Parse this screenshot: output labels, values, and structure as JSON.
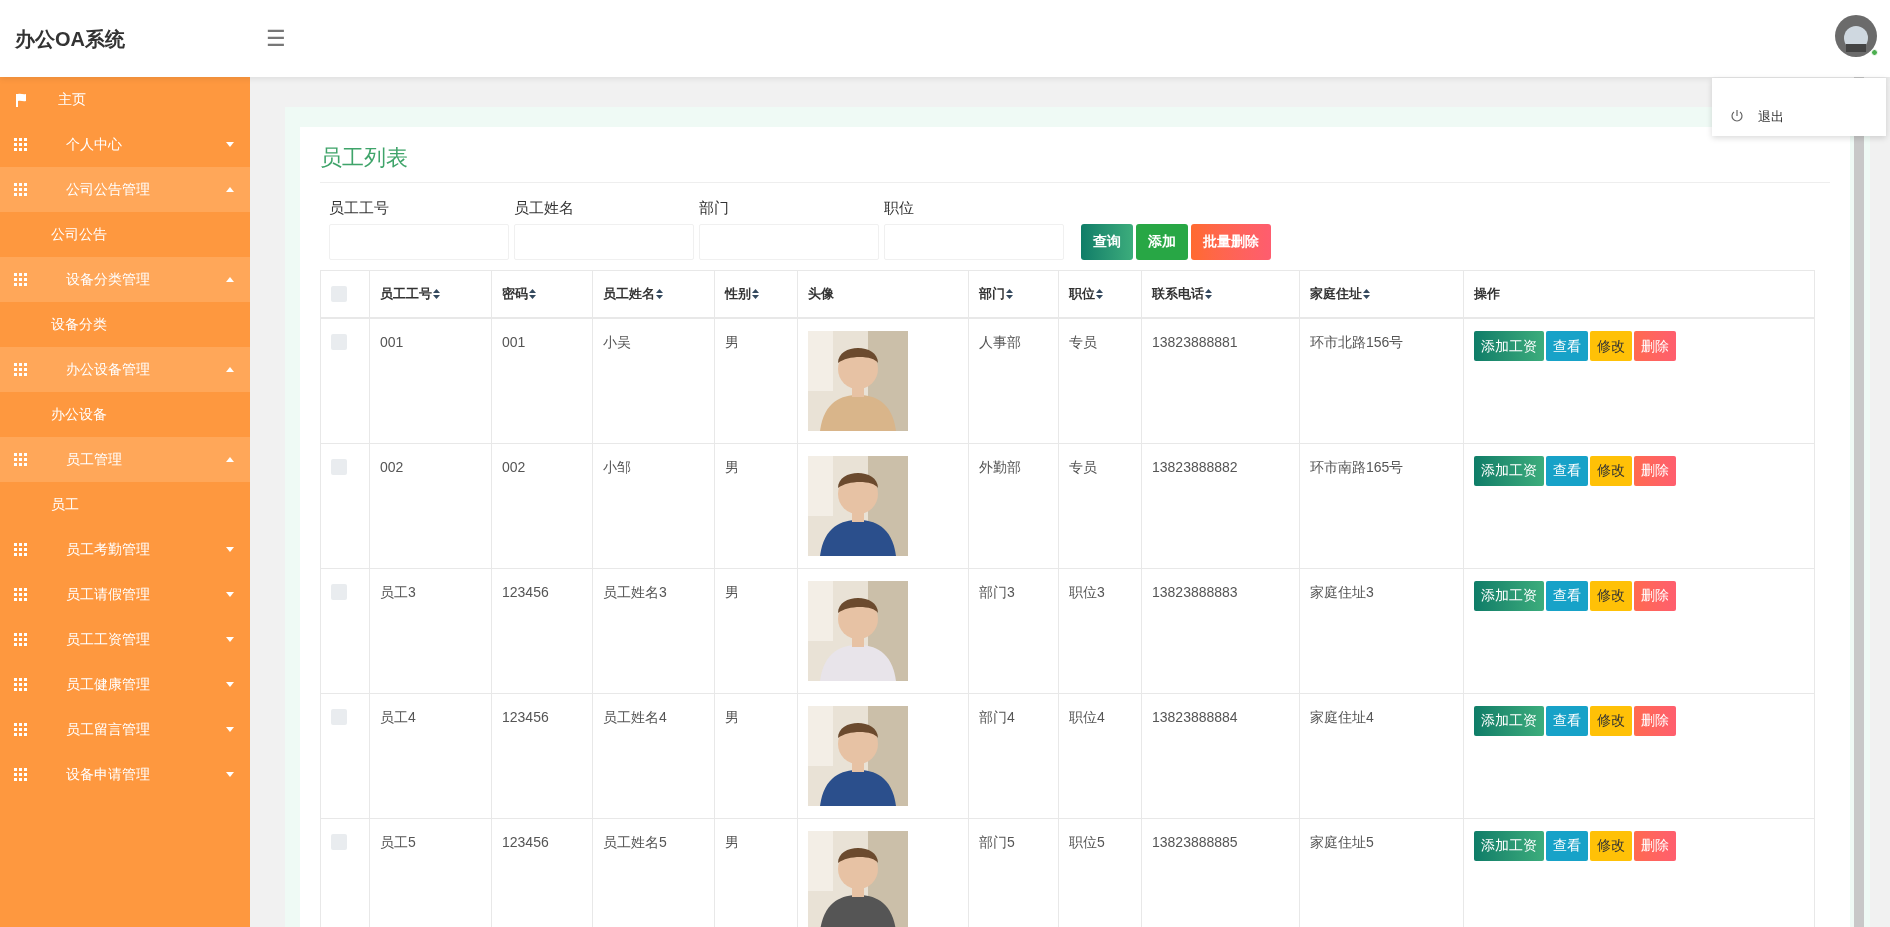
{
  "header": {
    "title": "办公OA系统",
    "menu_toggle": "☰",
    "online": true
  },
  "user_menu": {
    "items": [
      {
        "label": "退出"
      }
    ]
  },
  "sidebar": {
    "items": [
      {
        "label": "主页",
        "kind": "home"
      },
      {
        "label": "个人中心",
        "kind": "group",
        "expanded": false
      },
      {
        "label": "公司公告管理",
        "kind": "group",
        "expanded": true,
        "children": [
          {
            "label": "公司公告"
          }
        ]
      },
      {
        "label": "设备分类管理",
        "kind": "group",
        "expanded": true,
        "children": [
          {
            "label": "设备分类"
          }
        ]
      },
      {
        "label": "办公设备管理",
        "kind": "group",
        "expanded": true,
        "children": [
          {
            "label": "办公设备"
          }
        ]
      },
      {
        "label": "员工管理",
        "kind": "group",
        "expanded": true,
        "children": [
          {
            "label": "员工"
          }
        ]
      },
      {
        "label": "员工考勤管理",
        "kind": "group",
        "expanded": false
      },
      {
        "label": "员工请假管理",
        "kind": "group",
        "expanded": false
      },
      {
        "label": "员工工资管理",
        "kind": "group",
        "expanded": false
      },
      {
        "label": "员工健康管理",
        "kind": "group",
        "expanded": false
      },
      {
        "label": "员工留言管理",
        "kind": "group",
        "expanded": false
      },
      {
        "label": "设备申请管理",
        "kind": "group",
        "expanded": false
      }
    ]
  },
  "card": {
    "title": "员工列表",
    "filters": [
      {
        "label": "员工工号"
      },
      {
        "label": "员工姓名"
      },
      {
        "label": "部门"
      },
      {
        "label": "职位"
      }
    ],
    "buttons": [
      {
        "label": "查询",
        "kind": "search"
      },
      {
        "label": "添加",
        "kind": "add"
      },
      {
        "label": "批量删除",
        "kind": "danger"
      }
    ],
    "table": {
      "columns": [
        {
          "label": "员工工号",
          "sortable": true
        },
        {
          "label": "密码",
          "sortable": true
        },
        {
          "label": "员工姓名",
          "sortable": true
        },
        {
          "label": "性别",
          "sortable": true
        },
        {
          "label": "头像",
          "sortable": false
        },
        {
          "label": "部门",
          "sortable": true
        },
        {
          "label": "职位",
          "sortable": true
        },
        {
          "label": "联系电话",
          "sortable": true
        },
        {
          "label": "家庭住址",
          "sortable": true
        },
        {
          "label": "操作",
          "sortable": false
        }
      ],
      "all_checked": false,
      "rows": [
        {
          "checked": false,
          "cells": [
            "001",
            "001",
            "小吴",
            "男",
            {
              "kind": "picture"
            },
            "人事部",
            "专员",
            "13823888881",
            "环市北路156号"
          ],
          "actions": [
            {
              "label": "添加工资",
              "kind": "salary"
            },
            {
              "label": "查看",
              "kind": "view"
            },
            {
              "label": "修改",
              "kind": "edit"
            },
            {
              "label": "删除",
              "kind": "delete"
            }
          ]
        },
        {
          "checked": false,
          "cells": [
            "002",
            "002",
            "小邹",
            "男",
            {
              "kind": "picture"
            },
            "外勤部",
            "专员",
            "13823888882",
            "环市南路165号"
          ],
          "actions": [
            {
              "label": "添加工资",
              "kind": "salary"
            },
            {
              "label": "查看",
              "kind": "view"
            },
            {
              "label": "修改",
              "kind": "edit"
            },
            {
              "label": "删除",
              "kind": "delete"
            }
          ]
        },
        {
          "checked": false,
          "cells": [
            "员工3",
            "123456",
            "员工姓名3",
            "男",
            {
              "kind": "picture"
            },
            "部门3",
            "职位3",
            "13823888883",
            "家庭住址3"
          ],
          "actions": [
            {
              "label": "添加工资",
              "kind": "salary"
            },
            {
              "label": "查看",
              "kind": "view"
            },
            {
              "label": "修改",
              "kind": "edit"
            },
            {
              "label": "删除",
              "kind": "delete"
            }
          ]
        },
        {
          "checked": false,
          "cells": [
            "员工4",
            "123456",
            "员工姓名4",
            "男",
            {
              "kind": "picture"
            },
            "部门4",
            "职位4",
            "13823888884",
            "家庭住址4"
          ],
          "actions": [
            {
              "label": "添加工资",
              "kind": "salary"
            },
            {
              "label": "查看",
              "kind": "view"
            },
            {
              "label": "修改",
              "kind": "edit"
            },
            {
              "label": "删除",
              "kind": "delete"
            }
          ]
        },
        {
          "checked": false,
          "cells": [
            "员工5",
            "123456",
            "员工姓名5",
            "男",
            {
              "kind": "picture"
            },
            "部门5",
            "职位5",
            "13823888885",
            "家庭住址5"
          ],
          "actions": [
            {
              "label": "添加工资",
              "kind": "salary"
            },
            {
              "label": "查看",
              "kind": "view"
            },
            {
              "label": "修改",
              "kind": "edit"
            },
            {
              "label": "删除",
              "kind": "delete"
            }
          ]
        }
      ]
    }
  }
}
